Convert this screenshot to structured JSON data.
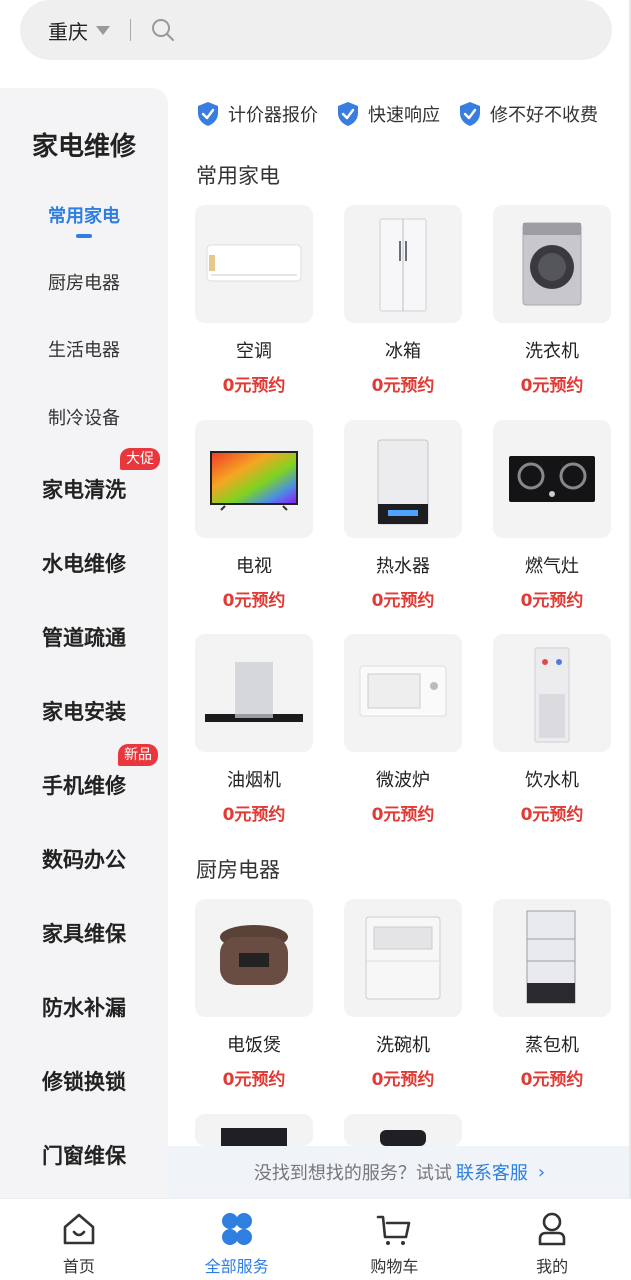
{
  "search": {
    "city": "重庆"
  },
  "sidebar": {
    "title": "家电维修",
    "sub_items": [
      {
        "label": "常用家电",
        "active": true
      },
      {
        "label": "厨房电器"
      },
      {
        "label": "生活电器"
      },
      {
        "label": "制冷设备"
      }
    ],
    "main_items": [
      {
        "label": "家电清洗",
        "badge": "大促"
      },
      {
        "label": "水电维修"
      },
      {
        "label": "管道疏通"
      },
      {
        "label": "家电安装"
      },
      {
        "label": "手机维修",
        "badge": "新品"
      },
      {
        "label": "数码办公"
      },
      {
        "label": "家具维保"
      },
      {
        "label": "防水补漏"
      },
      {
        "label": "修锁换锁"
      },
      {
        "label": "门窗维保"
      }
    ]
  },
  "guarantees": [
    "计价器报价",
    "快速响应",
    "修不好不收费"
  ],
  "sections": [
    {
      "title": "常用家电",
      "items": [
        {
          "name": "空调",
          "price": "0元预约",
          "icon": "air-conditioner"
        },
        {
          "name": "冰箱",
          "price": "0元预约",
          "icon": "refrigerator"
        },
        {
          "name": "洗衣机",
          "price": "0元预约",
          "icon": "washing-machine"
        },
        {
          "name": "电视",
          "price": "0元预约",
          "icon": "television"
        },
        {
          "name": "热水器",
          "price": "0元预约",
          "icon": "water-heater"
        },
        {
          "name": "燃气灶",
          "price": "0元预约",
          "icon": "gas-stove"
        },
        {
          "name": "油烟机",
          "price": "0元预约",
          "icon": "range-hood"
        },
        {
          "name": "微波炉",
          "price": "0元预约",
          "icon": "microwave"
        },
        {
          "name": "饮水机",
          "price": "0元预约",
          "icon": "water-dispenser"
        }
      ]
    },
    {
      "title": "厨房电器",
      "items": [
        {
          "name": "电饭煲",
          "price": "0元预约",
          "icon": "rice-cooker"
        },
        {
          "name": "洗碗机",
          "price": "0元预约",
          "icon": "dishwasher"
        },
        {
          "name": "蒸包机",
          "price": "0元预约",
          "icon": "bun-steamer"
        }
      ]
    }
  ],
  "help": {
    "text": "没找到想找的服务？试试",
    "link": "联系客服"
  },
  "tabbar": [
    {
      "label": "首页",
      "icon": "home-icon"
    },
    {
      "label": "全部服务",
      "icon": "all-services-icon",
      "active": true
    },
    {
      "label": "购物车",
      "icon": "cart-icon"
    },
    {
      "label": "我的",
      "icon": "profile-icon"
    }
  ],
  "colors": {
    "accent": "#2e7fe0",
    "price": "#e23a34",
    "badge": "#e8383d"
  }
}
